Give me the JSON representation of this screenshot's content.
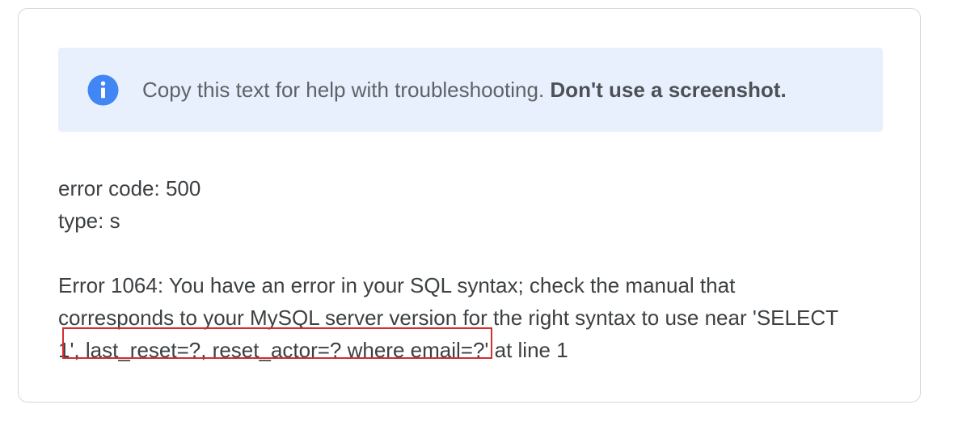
{
  "banner": {
    "icon": "info-icon",
    "icon_color": "#4285f4",
    "text": "Copy this text for help with troubleshooting.",
    "bold_text": "Don't use a screenshot."
  },
  "error": {
    "code_line": "error code: 500",
    "type_line": "type: s",
    "message_line1": "Error 1064: You have an error in your SQL syntax; check the manual that",
    "message_line2": "corresponds to your MySQL server version for the right syntax to use near 'SELECT",
    "message_line3": "1', last_reset=?, reset_actor=? where email=?' at line 1"
  },
  "annotation": {
    "highlight_color": "#d32f2f"
  }
}
